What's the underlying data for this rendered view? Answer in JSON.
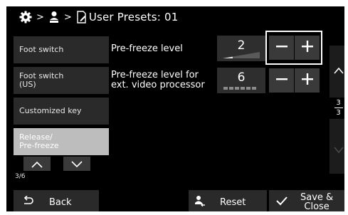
{
  "header": {
    "breadcrumb_sep_1": ">",
    "breadcrumb_sep_2": ">",
    "title": "User Presets: 01",
    "icons": [
      "gear-icon",
      "user-icon",
      "edit-document-icon"
    ]
  },
  "sidebar": {
    "items": [
      {
        "label": "Foot switch"
      },
      {
        "label": "Foot switch\n(US)"
      },
      {
        "label": "Customized key"
      },
      {
        "label": "Release/\nPre-freeze",
        "selected": true
      }
    ],
    "page_indicator": "3/6"
  },
  "settings": [
    {
      "label": "Pre-freeze level",
      "value": "2",
      "level": 2
    },
    {
      "label": "Pre-freeze level for\next. video processor",
      "value": "6",
      "level": 6
    }
  ],
  "scroll": {
    "page_current": "3",
    "page_total": "3"
  },
  "footer": {
    "back_label": "Back",
    "reset_label": "Reset",
    "save_label": "Save &\nClose"
  },
  "colors": {
    "background": "#000000",
    "button": "#2a2a2a",
    "selected": "#bdbdbd",
    "frame": "#ffffff"
  }
}
